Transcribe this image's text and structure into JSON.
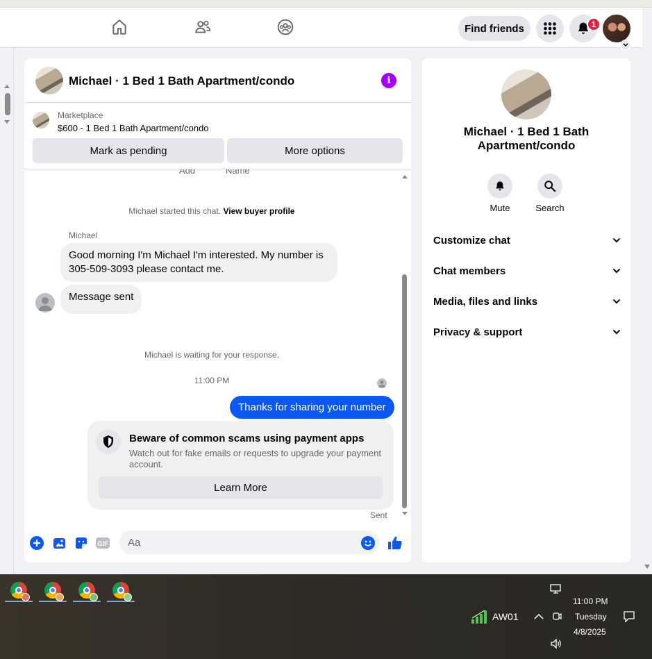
{
  "nav": {
    "find_friends": "Find friends",
    "notification_count": "1"
  },
  "conversation": {
    "title": "Michael · 1 Bed 1 Bath Apartment/condo",
    "marketplace_label": "Marketplace",
    "listing": "$600 - 1 Bed 1 Bath Apartment/condo",
    "mark_pending": "Mark as pending",
    "more_options": "More options"
  },
  "messages": {
    "cut_left": "Add",
    "cut_right": "Name",
    "started_text": "Michael started this chat.",
    "buyer_profile_link": "View buyer profile",
    "sender": "Michael",
    "incoming_1": "Good morning I'm Michael I'm interested.  My number is 305-509-3093 please contact me.",
    "incoming_2": "Message sent",
    "waiting": "Michael is waiting for your response.",
    "timestamp": "11:00 PM",
    "outgoing_1": "Thanks for sharing your number",
    "scam_title": "Beware of common scams using payment apps",
    "scam_desc": "Watch out for fake emails or requests to upgrade your payment account.",
    "learn_more": "Learn More",
    "sent_status": "Sent"
  },
  "composer": {
    "placeholder": "Aa",
    "gif_label": "GIF"
  },
  "info_panel": {
    "title": "Michael · 1 Bed 1 Bath Apartment/condo",
    "mute": "Mute",
    "search": "Search",
    "sections": [
      "Customize chat",
      "Chat members",
      "Media, files and links",
      "Privacy & support"
    ]
  },
  "taskbar": {
    "network_name": "AW01",
    "time": "11:00 PM",
    "day": "Tuesday",
    "date": "4/8/2025"
  },
  "colors": {
    "accent_blue": "#0a59f7",
    "info_purple": "#a100ff",
    "badge_red": "#e41e3f"
  },
  "icons": [
    "home-icon",
    "friends-icon",
    "groups-icon",
    "menu-grid-icon",
    "bell-icon",
    "info-icon",
    "shield-icon",
    "plus-circle-icon",
    "gallery-icon",
    "sticker-icon",
    "gif-icon",
    "emoji-icon",
    "thumbs-up-icon",
    "chevron-down-icon",
    "search-icon",
    "chrome-icon",
    "wifi-icon",
    "speaker-icon",
    "notification-center-icon"
  ]
}
